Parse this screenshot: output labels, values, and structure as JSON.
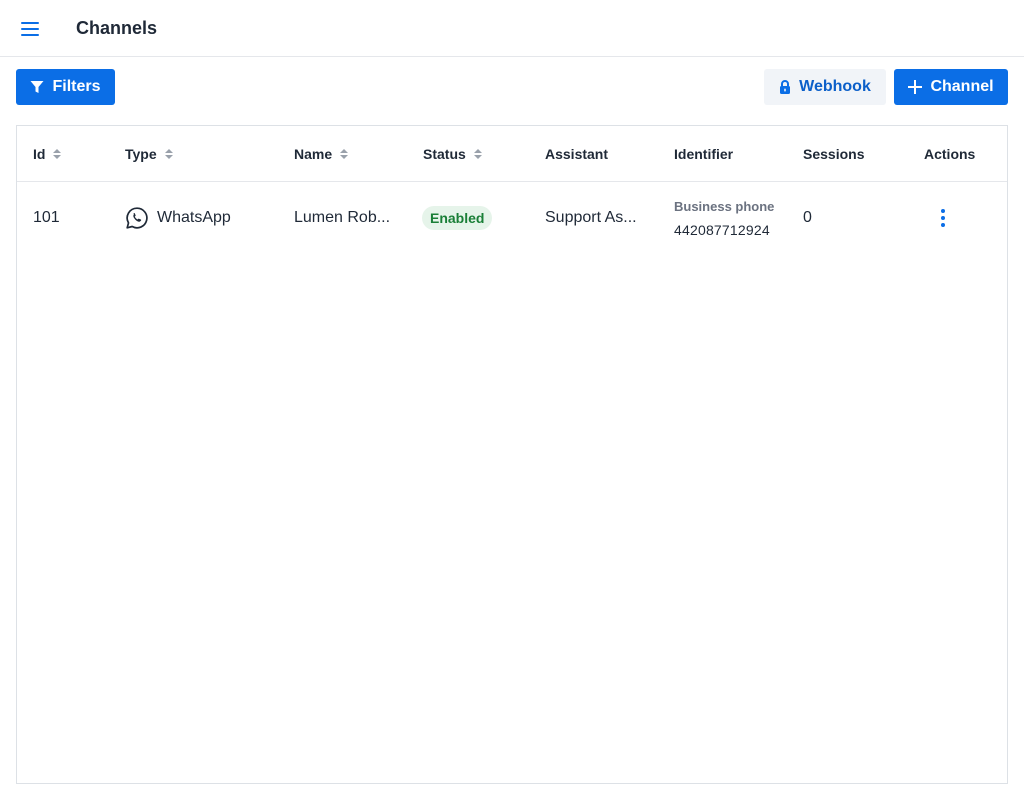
{
  "header": {
    "title": "Channels",
    "menu_icon": "hamburger-icon"
  },
  "toolbar": {
    "filters_label": "Filters",
    "webhook_label": "Webhook",
    "add_channel_label": "Channel",
    "colors": {
      "primary": "#0b6ee6",
      "light_bg": "#f1f4f8"
    }
  },
  "table": {
    "columns": {
      "id": "Id",
      "type": "Type",
      "name": "Name",
      "status": "Status",
      "assistant": "Assistant",
      "identifier": "Identifier",
      "sessions": "Sessions",
      "actions": "Actions"
    },
    "rows": [
      {
        "id": "101",
        "type": "WhatsApp",
        "type_icon": "whatsapp-icon",
        "name": "Lumen Rob...",
        "status": "Enabled",
        "assistant": "Support As...",
        "identifier_label": "Business phone",
        "identifier_value": "442087712924",
        "sessions": "0"
      }
    ]
  }
}
